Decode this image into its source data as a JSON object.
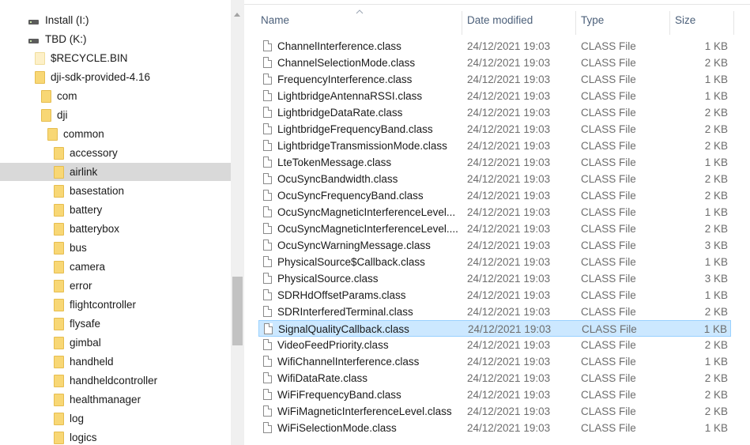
{
  "nav": {
    "items": [
      {
        "label": "Install (I:)",
        "icon": "drive-icon",
        "indent": 0
      },
      {
        "label": "TBD (K:)",
        "icon": "drive-icon",
        "indent": 0
      },
      {
        "label": "$RECYCLE.BIN",
        "icon": "folder-pale-icon",
        "indent": 1
      },
      {
        "label": "dji-sdk-provided-4.16",
        "icon": "folder-icon",
        "indent": 1
      },
      {
        "label": "com",
        "icon": "folder-icon",
        "indent": 2
      },
      {
        "label": "dji",
        "icon": "folder-icon",
        "indent": 2
      },
      {
        "label": "common",
        "icon": "folder-icon",
        "indent": 3
      },
      {
        "label": "accessory",
        "icon": "folder-icon",
        "indent": 4
      },
      {
        "label": "airlink",
        "icon": "folder-icon",
        "indent": 4,
        "selected": true
      },
      {
        "label": "basestation",
        "icon": "folder-icon",
        "indent": 4
      },
      {
        "label": "battery",
        "icon": "folder-icon",
        "indent": 4
      },
      {
        "label": "batterybox",
        "icon": "folder-icon",
        "indent": 4
      },
      {
        "label": "bus",
        "icon": "folder-icon",
        "indent": 4
      },
      {
        "label": "camera",
        "icon": "folder-icon",
        "indent": 4
      },
      {
        "label": "error",
        "icon": "folder-icon",
        "indent": 4
      },
      {
        "label": "flightcontroller",
        "icon": "folder-icon",
        "indent": 4
      },
      {
        "label": "flysafe",
        "icon": "folder-icon",
        "indent": 4
      },
      {
        "label": "gimbal",
        "icon": "folder-icon",
        "indent": 4
      },
      {
        "label": "handheld",
        "icon": "folder-icon",
        "indent": 4
      },
      {
        "label": "handheldcontroller",
        "icon": "folder-icon",
        "indent": 4
      },
      {
        "label": "healthmanager",
        "icon": "folder-icon",
        "indent": 4
      },
      {
        "label": "log",
        "icon": "folder-icon",
        "indent": 4
      },
      {
        "label": "logics",
        "icon": "folder-icon",
        "indent": 4
      }
    ]
  },
  "columns": {
    "name": "Name",
    "date": "Date modified",
    "type": "Type",
    "size": "Size"
  },
  "files": [
    {
      "name": "ChannelInterference.class",
      "date": "24/12/2021 19:03",
      "type": "CLASS File",
      "size": "1 KB"
    },
    {
      "name": "ChannelSelectionMode.class",
      "date": "24/12/2021 19:03",
      "type": "CLASS File",
      "size": "2 KB"
    },
    {
      "name": "FrequencyInterference.class",
      "date": "24/12/2021 19:03",
      "type": "CLASS File",
      "size": "1 KB"
    },
    {
      "name": "LightbridgeAntennaRSSI.class",
      "date": "24/12/2021 19:03",
      "type": "CLASS File",
      "size": "1 KB"
    },
    {
      "name": "LightbridgeDataRate.class",
      "date": "24/12/2021 19:03",
      "type": "CLASS File",
      "size": "2 KB"
    },
    {
      "name": "LightbridgeFrequencyBand.class",
      "date": "24/12/2021 19:03",
      "type": "CLASS File",
      "size": "2 KB"
    },
    {
      "name": "LightbridgeTransmissionMode.class",
      "date": "24/12/2021 19:03",
      "type": "CLASS File",
      "size": "2 KB"
    },
    {
      "name": "LteTokenMessage.class",
      "date": "24/12/2021 19:03",
      "type": "CLASS File",
      "size": "1 KB"
    },
    {
      "name": "OcuSyncBandwidth.class",
      "date": "24/12/2021 19:03",
      "type": "CLASS File",
      "size": "2 KB"
    },
    {
      "name": "OcuSyncFrequencyBand.class",
      "date": "24/12/2021 19:03",
      "type": "CLASS File",
      "size": "2 KB"
    },
    {
      "name": "OcuSyncMagneticInterferenceLevel...",
      "date": "24/12/2021 19:03",
      "type": "CLASS File",
      "size": "1 KB"
    },
    {
      "name": "OcuSyncMagneticInterferenceLevel....",
      "date": "24/12/2021 19:03",
      "type": "CLASS File",
      "size": "2 KB"
    },
    {
      "name": "OcuSyncWarningMessage.class",
      "date": "24/12/2021 19:03",
      "type": "CLASS File",
      "size": "3 KB"
    },
    {
      "name": "PhysicalSource$Callback.class",
      "date": "24/12/2021 19:03",
      "type": "CLASS File",
      "size": "1 KB"
    },
    {
      "name": "PhysicalSource.class",
      "date": "24/12/2021 19:03",
      "type": "CLASS File",
      "size": "3 KB"
    },
    {
      "name": "SDRHdOffsetParams.class",
      "date": "24/12/2021 19:03",
      "type": "CLASS File",
      "size": "1 KB"
    },
    {
      "name": "SDRInterferedTerminal.class",
      "date": "24/12/2021 19:03",
      "type": "CLASS File",
      "size": "2 KB"
    },
    {
      "name": "SignalQualityCallback.class",
      "date": "24/12/2021 19:03",
      "type": "CLASS File",
      "size": "1 KB",
      "selected": true
    },
    {
      "name": "VideoFeedPriority.class",
      "date": "24/12/2021 19:03",
      "type": "CLASS File",
      "size": "2 KB"
    },
    {
      "name": "WifiChannelInterference.class",
      "date": "24/12/2021 19:03",
      "type": "CLASS File",
      "size": "1 KB"
    },
    {
      "name": "WifiDataRate.class",
      "date": "24/12/2021 19:03",
      "type": "CLASS File",
      "size": "2 KB"
    },
    {
      "name": "WiFiFrequencyBand.class",
      "date": "24/12/2021 19:03",
      "type": "CLASS File",
      "size": "2 KB"
    },
    {
      "name": "WiFiMagneticInterferenceLevel.class",
      "date": "24/12/2021 19:03",
      "type": "CLASS File",
      "size": "2 KB"
    },
    {
      "name": "WiFiSelectionMode.class",
      "date": "24/12/2021 19:03",
      "type": "CLASS File",
      "size": "1 KB"
    }
  ],
  "colors": {
    "selected_row_bg": "#cce8ff",
    "selected_row_border": "#99d1ff",
    "selected_nav_bg": "#d9d9d9",
    "header_text": "#4c607a",
    "folder": "#f8d775"
  }
}
